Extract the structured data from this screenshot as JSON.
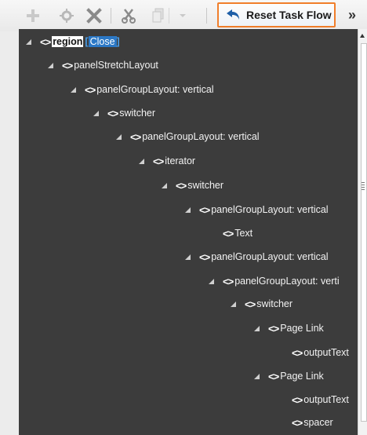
{
  "toolbar": {
    "add_icon": "plus-icon",
    "edit_icon": "gear-icon",
    "delete_icon": "x-icon",
    "cut_icon": "scissors-icon",
    "copy_icon": "copy-icon",
    "dropdown_icon": "chevron-down-icon",
    "reset_label": "Reset Task Flow",
    "reset_icon": "undo-arrow-icon",
    "overflow_label": "»"
  },
  "tree": {
    "region_label": "region",
    "close_label": "Close",
    "bracket_open": "[",
    "bracket_close": "]",
    "tag_glyph": "<>",
    "nodes": [
      "region",
      "panelStretchLayout",
      "panelGroupLayout: vertical",
      "switcher",
      "panelGroupLayout: vertical",
      "iterator",
      "switcher",
      "panelGroupLayout: vertical",
      "Text",
      "panelGroupLayout: vertical",
      "panelGroupLayout: verti",
      "switcher",
      "Page Link",
      "outputText",
      "Page Link",
      "outputText",
      "spacer"
    ]
  },
  "colors": {
    "tree_bg": "#3c3c3c",
    "highlight_border": "#f07e2b",
    "link_blue": "#2b78c6"
  }
}
